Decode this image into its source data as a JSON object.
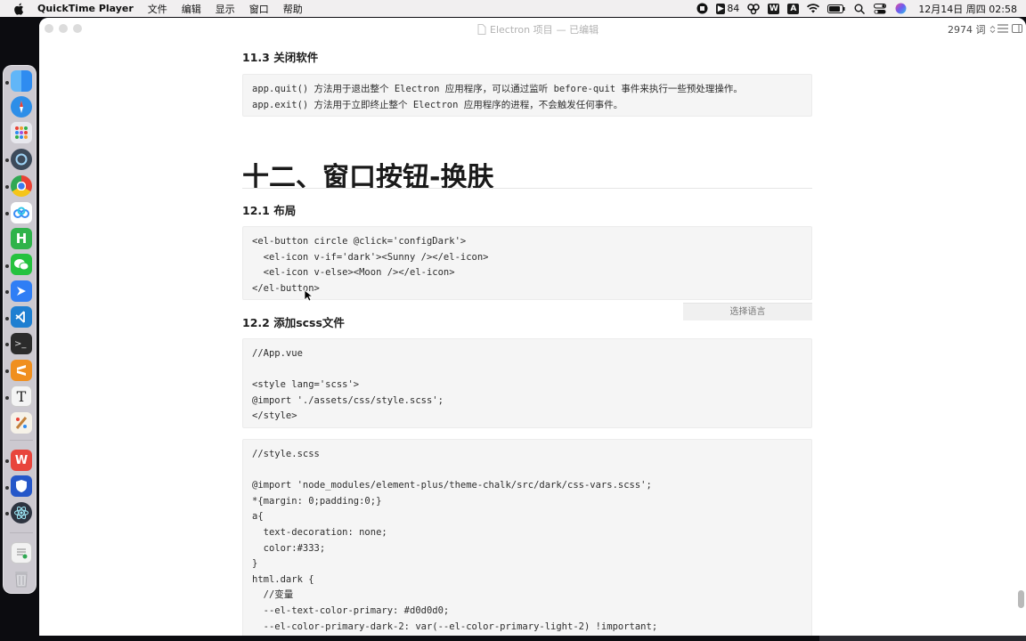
{
  "menubar": {
    "app_name": "QuickTime Player",
    "items": [
      "文件",
      "编辑",
      "显示",
      "窗口",
      "帮助"
    ],
    "status": {
      "badge_count": "84",
      "clock": "12月14日 周四  02:58"
    }
  },
  "dock": {
    "apps": [
      {
        "name": "finder",
        "color": "#2f8cf0"
      },
      {
        "name": "safari",
        "color": "#2d8ee8"
      },
      {
        "name": "launchpad",
        "color": "#e8e8ee"
      },
      {
        "name": "screen-recorder",
        "color": "#3d4a5a"
      },
      {
        "name": "chrome",
        "color": "#e94235"
      },
      {
        "name": "baidu-netdisk",
        "color": "#3a8cf5"
      },
      {
        "name": "hbuilder",
        "color": "#2fb34a"
      },
      {
        "name": "wechat",
        "color": "#25c23e"
      },
      {
        "name": "feishu",
        "color": "#2f7ef5"
      },
      {
        "name": "vscode",
        "color": "#1f7fd1"
      },
      {
        "name": "terminal",
        "color": "#2b2b2b"
      },
      {
        "name": "sublime-text",
        "color": "#f08f1e"
      },
      {
        "name": "typora",
        "color": "#f4f4f4"
      },
      {
        "name": "paintbrush",
        "color": "#e0a93a"
      },
      {
        "name": "wps",
        "color": "#e8453c"
      },
      {
        "name": "vpn-shield",
        "color": "#2557c9"
      },
      {
        "name": "electron",
        "color": "#2e3440"
      },
      {
        "name": "document",
        "color": "#f2f2f2"
      },
      {
        "name": "trash",
        "color": "#d8d8dc"
      }
    ]
  },
  "window": {
    "title": "Electron 项目",
    "edited_label": "— 已编辑",
    "word_count": "2974 词"
  },
  "doc": {
    "h3_close": "11.3 关闭软件",
    "code_close": [
      "app.quit() 方法用于退出整个 Electron 应用程序，可以通过监听 before-quit 事件来执行一些预处理操作。",
      "app.exit() 方法用于立即终止整个 Electron 应用程序的进程，不会触发任何事件。"
    ],
    "h1": "十二、窗口按钮-换肤",
    "h3_layout": "12.1 布局",
    "code_layout": [
      "<el-button circle @click='configDark'>",
      "  <el-icon v-if='dark'><Sunny /></el-icon>",
      "  <el-icon v-else><Moon /></el-icon>",
      "</el-button>"
    ],
    "lang_select": "选择语言",
    "h3_scss": "12.2 添加scss文件",
    "code_app": [
      "//App.vue",
      "",
      "<style lang='scss'>",
      "@import './assets/css/style.scss';",
      "</style>"
    ],
    "code_style": [
      "//style.scss",
      "",
      "@import 'node_modules/element-plus/theme-chalk/src/dark/css-vars.scss';",
      "*{margin: 0;padding:0;}",
      "a{",
      "  text-decoration: none;",
      "  color:#333;",
      "}",
      "html.dark {",
      "  //变量",
      "  --el-text-color-primary: #d0d0d0;",
      "  --el-color-primary-dark-2: var(--el-color-primary-light-2) !important;"
    ]
  }
}
